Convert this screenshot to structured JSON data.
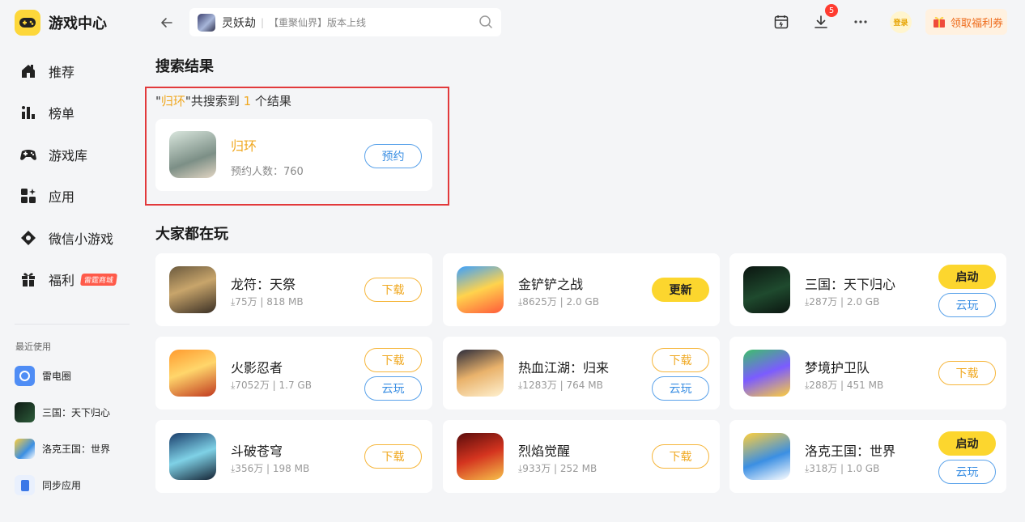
{
  "app": {
    "title": "游戏中心"
  },
  "sidebar": {
    "items": [
      {
        "label": "推荐",
        "icon": "home-icon"
      },
      {
        "label": "榜单",
        "icon": "ranking-icon"
      },
      {
        "label": "游戏库",
        "icon": "gamepad-icon"
      },
      {
        "label": "应用",
        "icon": "apps-icon"
      },
      {
        "label": "微信小游戏",
        "icon": "mini-game-icon"
      },
      {
        "label": "福利",
        "icon": "gift-icon",
        "badge": "雷霆商城"
      }
    ],
    "recent_title": "最近使用",
    "recent": [
      {
        "label": "雷电圈"
      },
      {
        "label": "三国：天下归心"
      },
      {
        "label": "洛克王国：世界"
      },
      {
        "label": "同步应用"
      }
    ]
  },
  "topbar": {
    "search_query": "灵妖劫",
    "search_hint": "【重聚仙界】版本上线",
    "download_count": "5",
    "login_label": "登录",
    "coupon_label": "领取福利券"
  },
  "search_results": {
    "title": "搜索结果",
    "summary_prefix": "\"",
    "keyword": "归环",
    "summary_mid": "\"共搜索到 ",
    "count": "1",
    "summary_suffix": " 个结果",
    "item": {
      "name": "归环",
      "sub": "预约人数：760",
      "button": "预约"
    }
  },
  "popular": {
    "title": "大家都在玩",
    "games": [
      {
        "name": "龙符：天祭",
        "meta": "⤓75万 | 818 MB",
        "buttons": [
          "下载"
        ]
      },
      {
        "name": "金铲铲之战",
        "meta": "⤓8625万 | 2.0 GB",
        "buttons": [
          "更新"
        ]
      },
      {
        "name": "三国：天下归心",
        "meta": "⤓287万 | 2.0 GB",
        "buttons": [
          "启动",
          "云玩"
        ]
      },
      {
        "name": "火影忍者",
        "meta": "⤓7052万 | 1.7 GB",
        "buttons": [
          "下载",
          "云玩"
        ]
      },
      {
        "name": "热血江湖：归来",
        "meta": "⤓1283万 | 764 MB",
        "buttons": [
          "下载",
          "云玩"
        ]
      },
      {
        "name": "梦境护卫队",
        "meta": "⤓288万 | 451 MB",
        "buttons": [
          "下载"
        ]
      },
      {
        "name": "斗破苍穹",
        "meta": "⤓356万 | 198 MB",
        "buttons": [
          "下载"
        ]
      },
      {
        "name": "烈焰觉醒",
        "meta": "⤓933万 | 252 MB",
        "buttons": [
          "下载"
        ]
      },
      {
        "name": "洛克王国：世界",
        "meta": "⤓318万 | 1.0 GB",
        "buttons": [
          "启动",
          "云玩"
        ]
      }
    ]
  }
}
